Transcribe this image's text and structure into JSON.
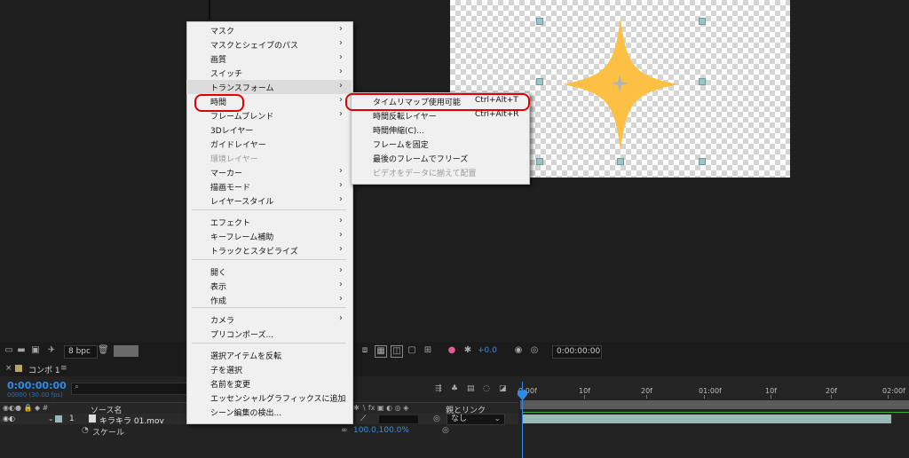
{
  "context_menu": {
    "items": [
      {
        "label": "マスク",
        "submenu": true
      },
      {
        "label": "マスクとシェイプのパス",
        "submenu": true
      },
      {
        "label": "画質",
        "submenu": true
      },
      {
        "label": "スイッチ",
        "submenu": true
      },
      {
        "label": "トランスフォーム",
        "submenu": true
      },
      {
        "label": "時間",
        "submenu": true
      },
      {
        "label": "フレームブレンド",
        "submenu": true
      },
      {
        "label": "3Dレイヤー"
      },
      {
        "label": "ガイドレイヤー"
      },
      {
        "label": "環境レイヤー",
        "disabled": true
      },
      {
        "label": "マーカー",
        "submenu": true
      },
      {
        "label": "描画モード",
        "submenu": true
      },
      {
        "label": "レイヤースタイル",
        "submenu": true
      },
      {
        "label": "エフェクト",
        "submenu": true
      },
      {
        "label": "キーフレーム補助",
        "submenu": true
      },
      {
        "label": "トラックとスタビライズ",
        "submenu": true
      },
      {
        "label": "開く",
        "submenu": true
      },
      {
        "label": "表示",
        "submenu": true
      },
      {
        "label": "作成",
        "submenu": true
      },
      {
        "label": "カメラ",
        "submenu": true
      },
      {
        "label": "プリコンポーズ..."
      },
      {
        "label": "選択アイテムを反転"
      },
      {
        "label": "子を選択"
      },
      {
        "label": "名前を変更"
      },
      {
        "label": "エッセンシャルグラフィックスに追加"
      },
      {
        "label": "シーン編集の検出..."
      }
    ],
    "arrow": "›"
  },
  "time_submenu": {
    "items": [
      {
        "label": "タイムリマップ使用可能",
        "shortcut": "Ctrl+Alt+T"
      },
      {
        "label": "時間反転レイヤー",
        "shortcut": "Ctrl+Alt+R"
      },
      {
        "label": "時間伸縮(C)..."
      },
      {
        "label": "フレームを固定"
      },
      {
        "label": "最後のフレームでフリーズ"
      },
      {
        "label": "ビデオをデータに揃えて配置",
        "disabled": true
      }
    ]
  },
  "viewer_toolbar": {
    "bit_depth": "8 bpc",
    "exposure": "+0.0",
    "snapshot_time": "0:00:00:00"
  },
  "timeline": {
    "tab_label": "コンポ 1",
    "tab_menu": "≡",
    "timecode": "0:00:00:00",
    "timecode_sub": "00000 (30.00 fps)",
    "col_source_name": "ソース名",
    "col_parent_link": "親とリンク",
    "layer_number": "1",
    "layer_name": "キラキラ 01.mov",
    "parent_value": "なし",
    "property_name": "スケール",
    "property_value": "100.0,100.0%",
    "ruler_ticks": [
      "0:00f",
      "10f",
      "20f",
      "01:00f",
      "10f",
      "20f",
      "02:00f"
    ]
  },
  "colors": {
    "accent_blue": "#2d8ceb",
    "star": "#fbc044",
    "highlight_ring": "#e00000"
  }
}
